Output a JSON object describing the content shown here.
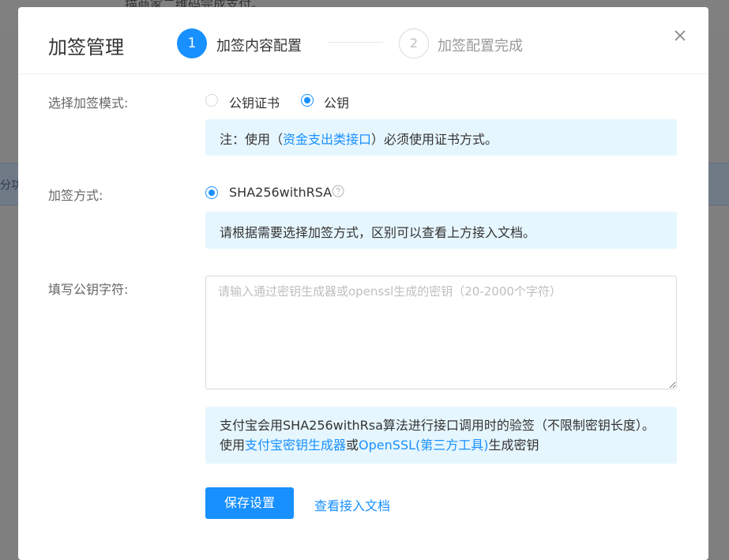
{
  "background": {
    "top_text": "描商家二维码完成支付。",
    "band_text": "分功"
  },
  "dialog": {
    "title": "加签管理",
    "steps": [
      {
        "number": "1",
        "label": "加签内容配置",
        "active": true
      },
      {
        "number": "2",
        "label": "加签配置完成",
        "active": false
      }
    ],
    "close_icon": "close-icon"
  },
  "form": {
    "mode": {
      "label": "选择加签模式:",
      "options": [
        {
          "label": "公钥证书",
          "checked": false
        },
        {
          "label": "公钥",
          "checked": true
        }
      ],
      "notice": {
        "prefix": "注：使用（",
        "link": "资金支出类接口",
        "suffix": "）必须使用证书方式。"
      }
    },
    "method": {
      "label": "加签方式:",
      "option": {
        "label": "SHA256withRSA",
        "checked": true
      },
      "help_icon": "question-circle-icon",
      "notice": "请根据需要选择加签方式，区别可以查看上方接入文档。"
    },
    "public_key": {
      "label": "填写公钥字符:",
      "value": "",
      "placeholder": "请输入通过密钥生成器或openssl生成的密钥（20-2000个字符）"
    },
    "info": {
      "text1": "支付宝会用SHA256withRsa算法进行接口调用时的验签（不限制密钥长度）。使用",
      "link1": "支付宝密钥生成器",
      "text2": "或",
      "link2": "OpenSSL(第三方工具)",
      "text3": "生成密钥"
    }
  },
  "actions": {
    "save_label": "保存设置",
    "doc_link_label": "查看接入文档"
  },
  "colors": {
    "primary": "#1890ff",
    "notice_bg": "#e6f6fe"
  }
}
